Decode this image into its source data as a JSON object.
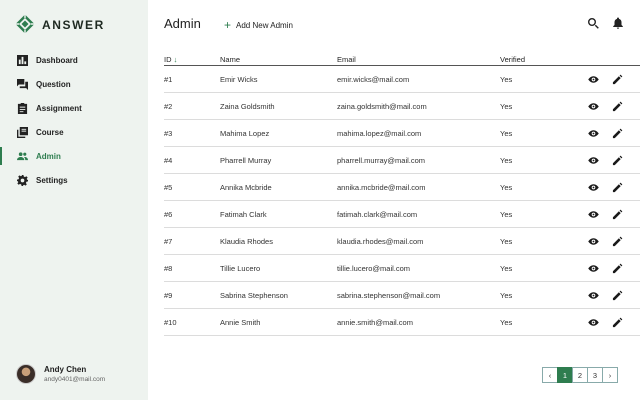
{
  "brand": {
    "name": "ANSWER"
  },
  "colors": {
    "accent": "#2e7d4f",
    "sidebar_bg": "#eef3ef"
  },
  "sidebar": {
    "items": [
      {
        "label": "Dashboard",
        "icon": "bar-chart-icon"
      },
      {
        "label": "Question",
        "icon": "forum-icon"
      },
      {
        "label": "Assignment",
        "icon": "clipboard-icon"
      },
      {
        "label": "Course",
        "icon": "library-books-icon"
      },
      {
        "label": "Admin",
        "icon": "people-icon",
        "active": true
      },
      {
        "label": "Settings",
        "icon": "gear-icon"
      }
    ]
  },
  "user": {
    "name": "Andy Chen",
    "email": "andy0401@mail.com"
  },
  "header": {
    "title": "Admin",
    "add_label": "Add New Admin",
    "add_icon": "plus-icon",
    "search_icon": "search-icon",
    "notifications_icon": "bell-icon"
  },
  "table": {
    "columns": {
      "id": "ID",
      "name": "Name",
      "email": "Email",
      "verified": "Verified"
    },
    "sort_icon": "arrow-down-icon",
    "rows": [
      {
        "id": "#1",
        "name": "Emir Wicks",
        "email": "emir.wicks@mail.com",
        "verified": "Yes"
      },
      {
        "id": "#2",
        "name": "Zaina Goldsmith",
        "email": "zaina.goldsmith@mail.com",
        "verified": "Yes"
      },
      {
        "id": "#3",
        "name": "Mahima Lopez",
        "email": "mahima.lopez@mail.com",
        "verified": "Yes"
      },
      {
        "id": "#4",
        "name": "Pharrell Murray",
        "email": "pharrell.murray@mail.com",
        "verified": "Yes"
      },
      {
        "id": "#5",
        "name": "Annika Mcbride",
        "email": "annika.mcbride@mail.com",
        "verified": "Yes"
      },
      {
        "id": "#6",
        "name": "Fatimah Clark",
        "email": "fatimah.clark@mail.com",
        "verified": "Yes"
      },
      {
        "id": "#7",
        "name": "Klaudia Rhodes",
        "email": "klaudia.rhodes@mail.com",
        "verified": "Yes"
      },
      {
        "id": "#8",
        "name": "Tillie Lucero",
        "email": "tillie.lucero@mail.com",
        "verified": "Yes"
      },
      {
        "id": "#9",
        "name": "Sabrina Stephenson",
        "email": "sabrina.stephenson@mail.com",
        "verified": "Yes"
      },
      {
        "id": "#10",
        "name": "Annie Smith",
        "email": "annie.smith@mail.com",
        "verified": "Yes"
      }
    ]
  },
  "pagination": {
    "pages": [
      "1",
      "2",
      "3"
    ],
    "current": "1",
    "prev_icon": "chevron-left-icon",
    "next_icon": "chevron-right-icon"
  }
}
